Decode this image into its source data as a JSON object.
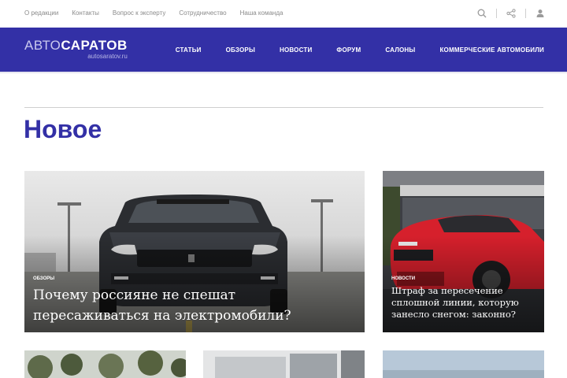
{
  "top_links": [
    "О редакции",
    "Контакты",
    "Вопрос к эксперту",
    "Сотрудничество",
    "Наша команда"
  ],
  "top_icons": [
    "search-icon",
    "share-icon",
    "user-icon"
  ],
  "logo": {
    "part_a": "АВТО",
    "part_b": "САРАТОВ",
    "sub": "autosaratov.ru"
  },
  "main_nav": [
    "СТАТЬИ",
    "ОБЗОРЫ",
    "НОВОСТИ",
    "ФОРУМ",
    "САЛОНЫ",
    "КОММЕРЧЕСКИЕ АВТОМОБИЛИ"
  ],
  "section_title": "Новое",
  "cards": [
    {
      "rubric": "ОБЗОРЫ",
      "headline": "Почему россияне не спешат пересаживаться на электромобили?"
    },
    {
      "rubric": "НОВОСТИ",
      "headline": "Штраф за пересечение сплошной линии, которую занесло снегом: законно?"
    }
  ],
  "colors": {
    "brand": "#3330a6",
    "top_link": "#8a8a8a",
    "white": "#ffffff"
  }
}
